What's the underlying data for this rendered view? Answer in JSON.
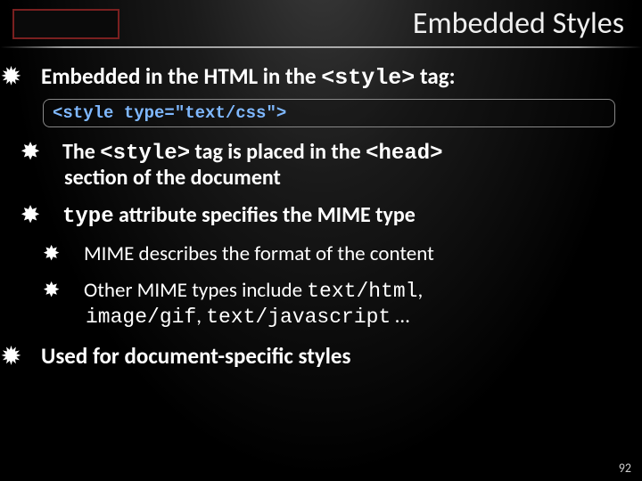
{
  "title": "Embedded Styles",
  "bullets": {
    "b1_pre": "Embedded in the HTML in the ",
    "b1_code": "<style>",
    "b1_post": " tag:",
    "codebox": "<style type=\"text/css\">",
    "b2a_pre": "The ",
    "b2a_code1": "<style>",
    "b2a_mid": " tag is placed in the ",
    "b2a_code2": "<head>",
    "b2a_cont": "section of the document",
    "b2b_code": "type",
    "b2b_post": " attribute specifies the MIME type",
    "b3a": "MIME describes the format of the content",
    "b3b_pre": "Other MIME types include ",
    "b3b_c1": "text/html",
    "b3b_sep1": ", ",
    "b3b_c2": "image/gif",
    "b3b_sep2": ", ",
    "b3b_c3": "text/javascript",
    "b3b_post": " …",
    "b4": "Used for document-specific styles"
  },
  "glyphs": {
    "lvl1": "✹",
    "lvl2": "✸",
    "lvl3": "✸"
  },
  "page_number": "92"
}
